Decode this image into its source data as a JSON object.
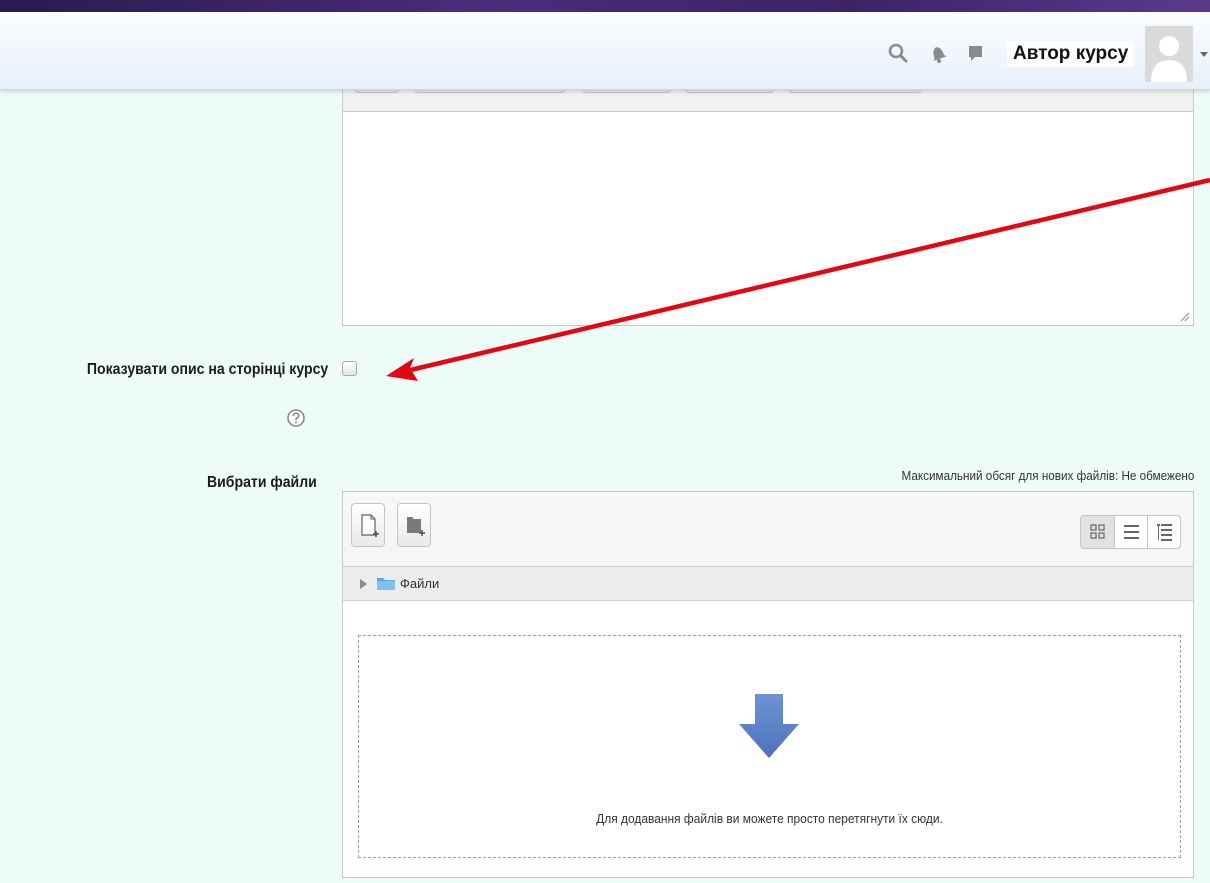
{
  "header": {
    "user_name": "Автор курсу",
    "icons": [
      "search-icon",
      "bell-icon",
      "message-icon",
      "user-avatar",
      "chevron-down-icon"
    ]
  },
  "form": {
    "show_description_label": "Показувати опис на сторінці курсу",
    "show_description_checked": false,
    "select_files_label": "Вибрати файли",
    "max_size_text": "Максимальний обсяг для нових файлів: Не обмежено"
  },
  "filemanager": {
    "toolbar_icons": [
      "add-file-icon",
      "create-folder-icon"
    ],
    "view_icons": [
      "grid-view-icon",
      "list-view-icon",
      "tree-view-icon"
    ],
    "active_view": "grid",
    "path_label": "Файли",
    "drop_text": "Для додавання файлів ви можете просто перетягнути їх сюди."
  },
  "colors": {
    "page_background": "#eefcf9",
    "annotation_arrow": "#e30613",
    "drop_arrow": "#5e83c8"
  }
}
